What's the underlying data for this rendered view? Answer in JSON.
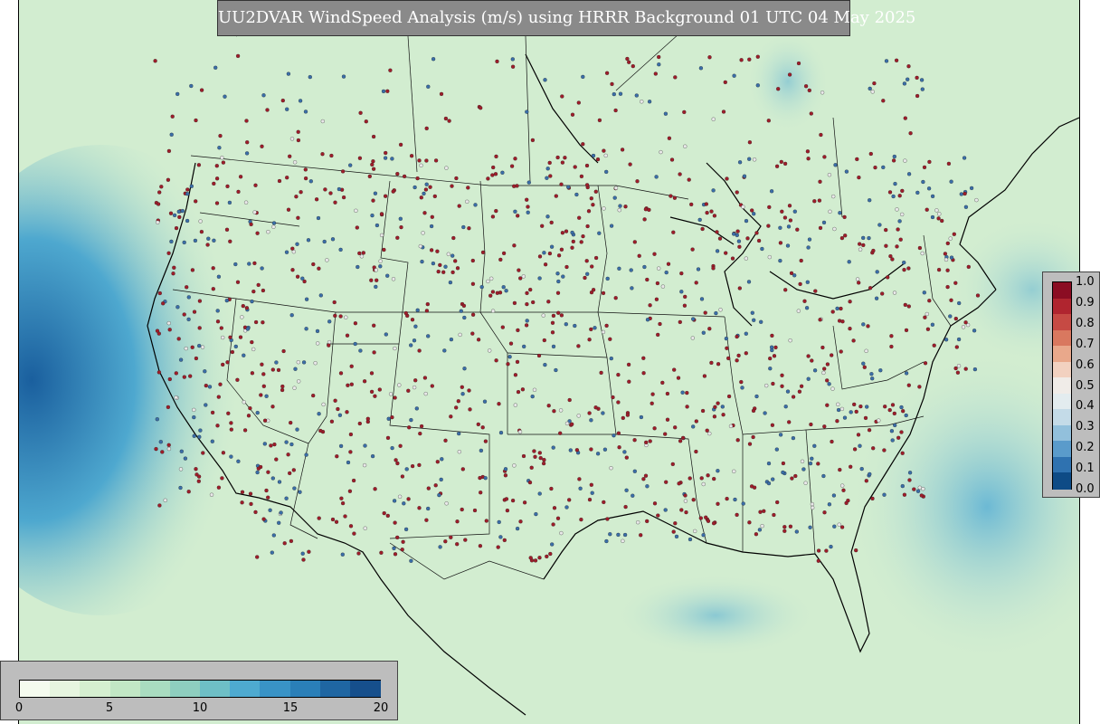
{
  "title": "UU2DVAR WindSpeed Analysis (m/s) using HRRR Background 01 UTC 04 May 2025",
  "colors": {
    "land_bg": "#d2edd0",
    "ocean_blue": "#2a7fb8",
    "border": "#000000",
    "dot_red": "#9e1d2a",
    "dot_blue": "#3a6ea8",
    "legend_bg": "#bdbdbd"
  },
  "speed_colorbar": {
    "ticks": [
      "0",
      "5",
      "10",
      "15",
      "20"
    ],
    "colors": [
      "#f5fbef",
      "#e6f5df",
      "#d5efd0",
      "#c2e7c5",
      "#a9dcc0",
      "#8ecebf",
      "#6ebfc6",
      "#4eaad0",
      "#3993c6",
      "#2a7fb8",
      "#1f66a2",
      "#164f8c"
    ]
  },
  "ratio_colorbar": {
    "ticks": [
      "1.0",
      "0.9",
      "0.8",
      "0.7",
      "0.6",
      "0.5",
      "0.4",
      "0.3",
      "0.2",
      "0.1",
      "0.0"
    ],
    "colors": [
      "#8b0d23",
      "#b0252f",
      "#c64a44",
      "#d9785f",
      "#e9a88b",
      "#f2d1c0",
      "#f0ece8",
      "#e3ecef",
      "#c4dbe8",
      "#92c0dc",
      "#5a9bcb",
      "#2f72b0",
      "#0e4b86"
    ]
  }
}
